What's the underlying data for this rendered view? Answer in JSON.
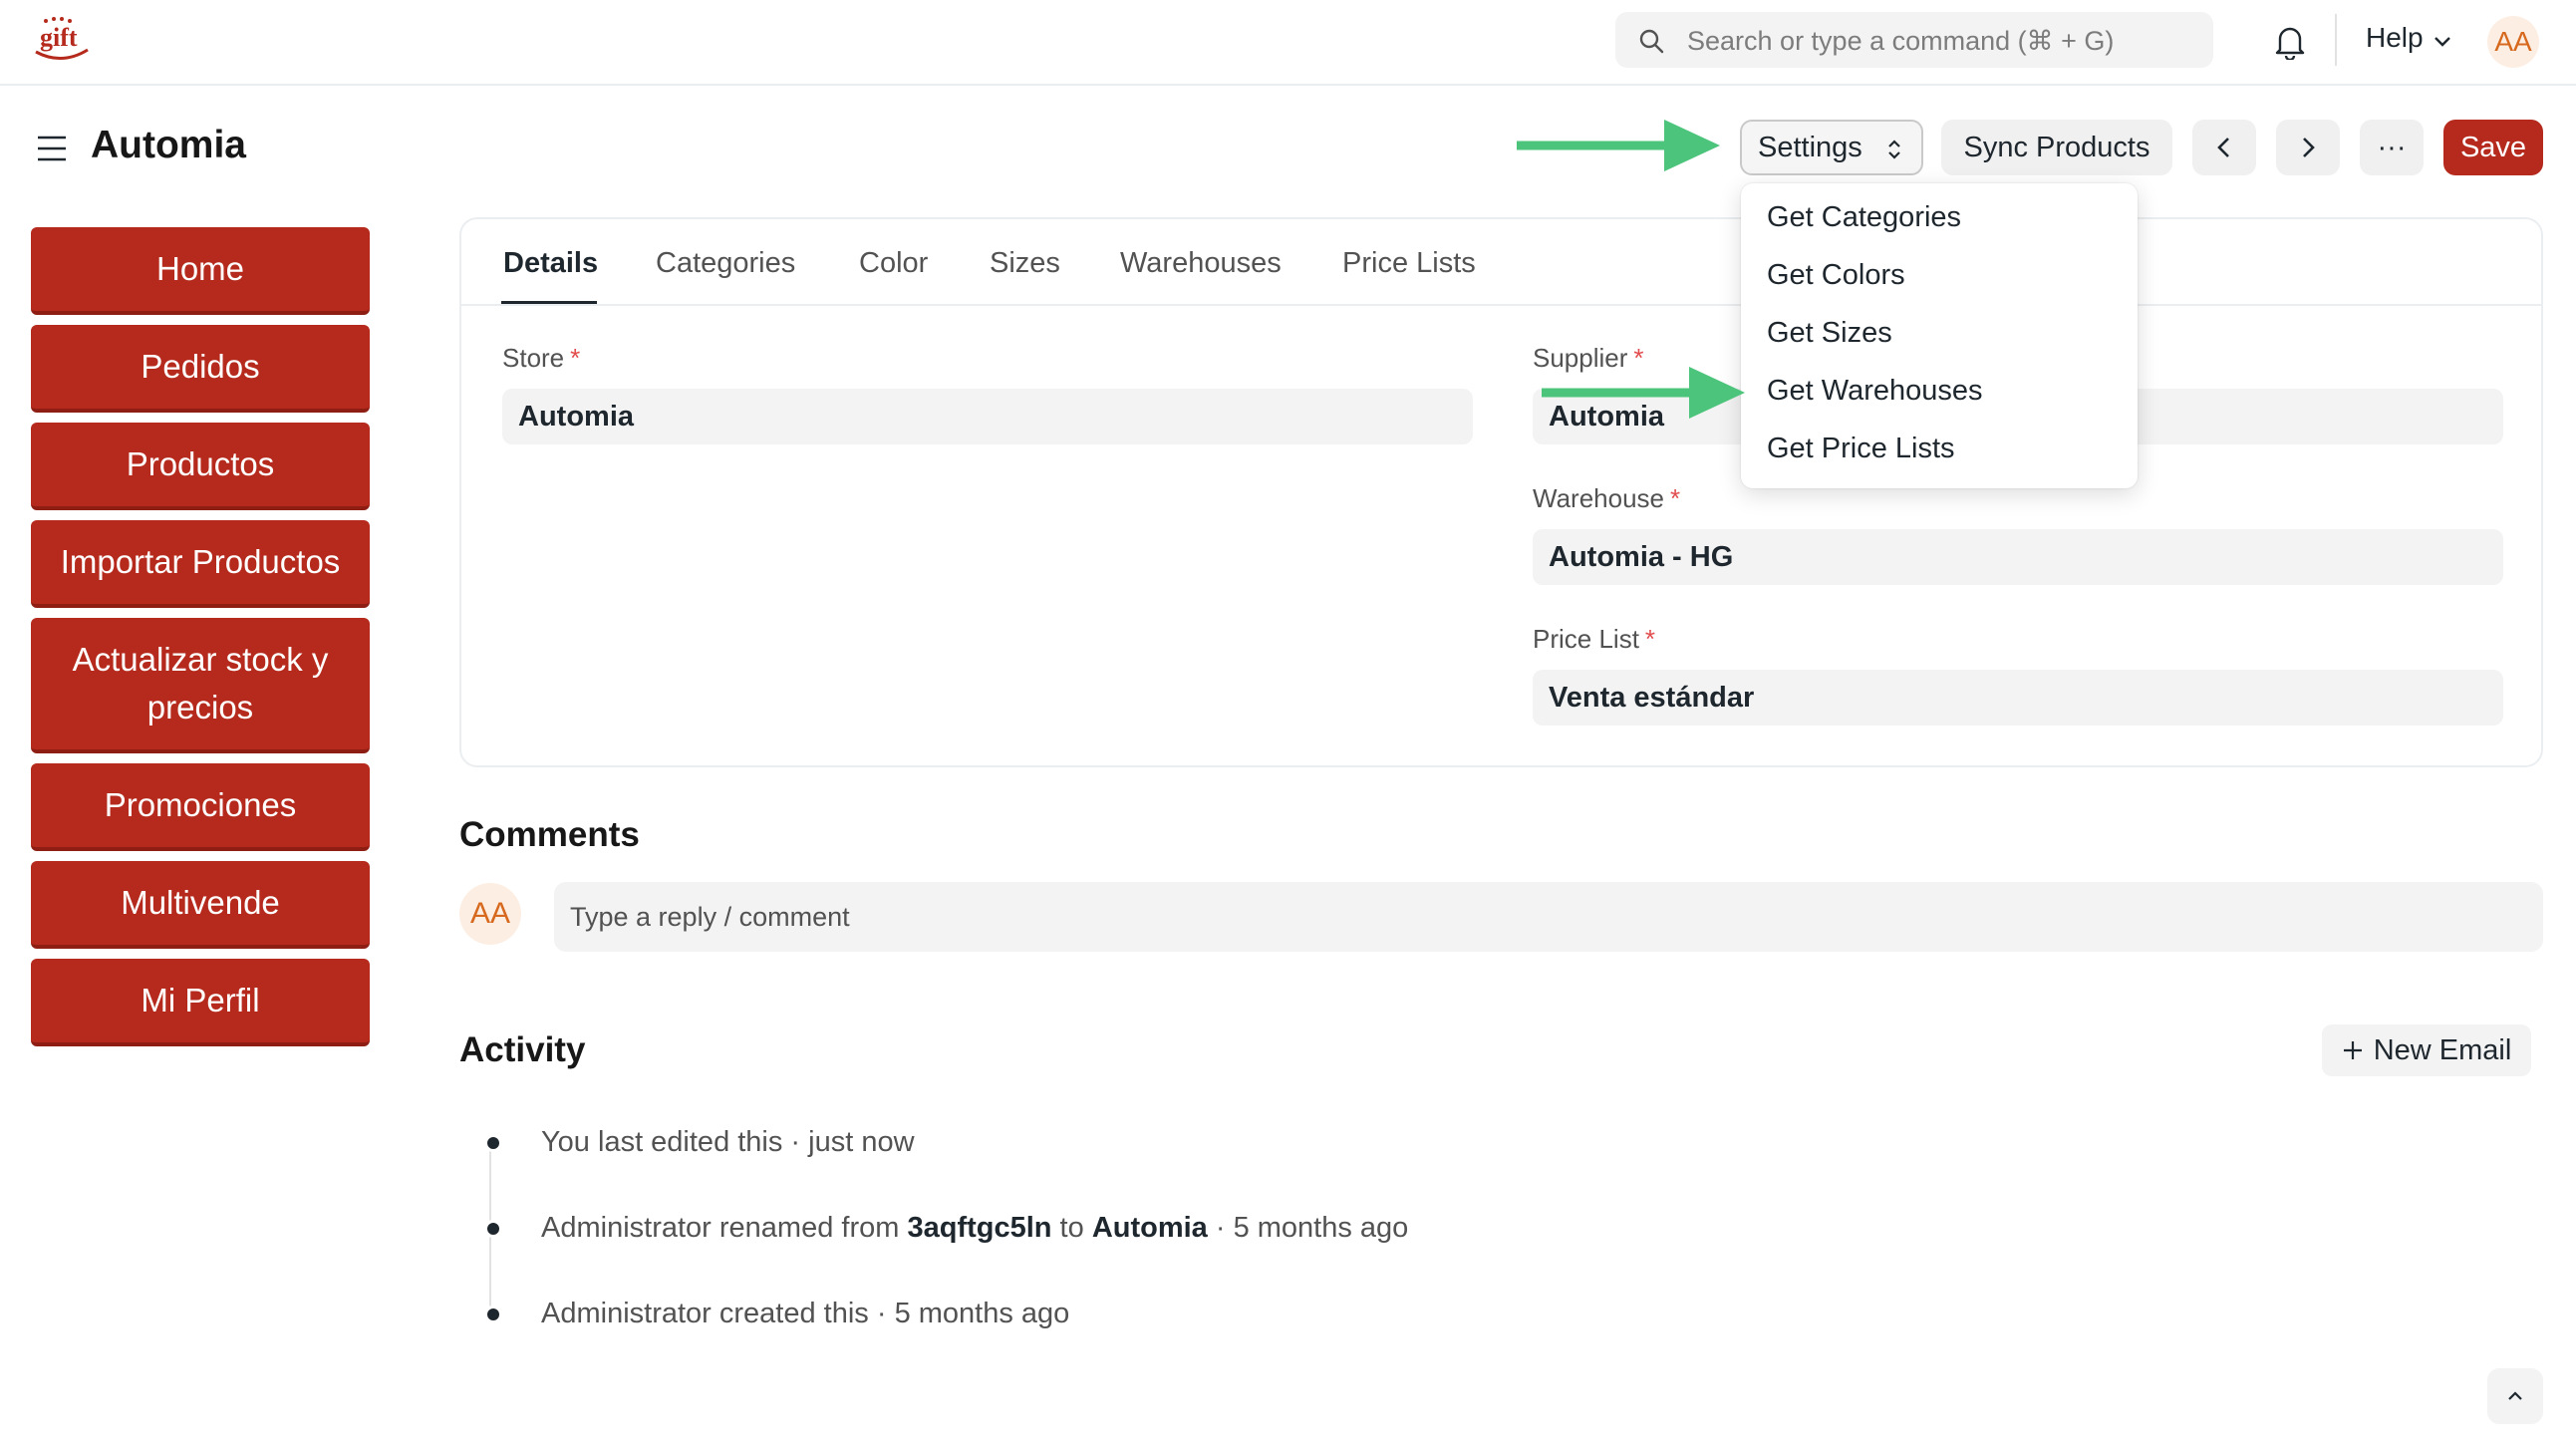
{
  "navbar": {
    "logo_text": "gift",
    "search_placeholder": "Search or type a command (⌘ + G)",
    "help_label": "Help",
    "user_initials": "AA"
  },
  "header": {
    "title": "Automia",
    "settings_label": "Settings",
    "sync_label": "Sync Products",
    "more_label": "···",
    "save_label": "Save"
  },
  "sidebar": {
    "items": [
      {
        "label": "Home"
      },
      {
        "label": "Pedidos"
      },
      {
        "label": "Productos"
      },
      {
        "label": "Importar Productos"
      },
      {
        "label": "Actualizar stock y precios"
      },
      {
        "label": "Promociones"
      },
      {
        "label": "Multivende"
      },
      {
        "label": "Mi Perfil"
      }
    ]
  },
  "tabs": [
    {
      "label": "Details",
      "active": true
    },
    {
      "label": "Categories"
    },
    {
      "label": "Color"
    },
    {
      "label": "Sizes"
    },
    {
      "label": "Warehouses"
    },
    {
      "label": "Price Lists"
    }
  ],
  "form": {
    "store": {
      "label": "Store",
      "value": "Automia",
      "required": "*"
    },
    "supplier": {
      "label": "Supplier",
      "value": "Automia",
      "required": "*"
    },
    "warehouse": {
      "label": "Warehouse",
      "value": "Automia - HG",
      "required": "*"
    },
    "price_list": {
      "label": "Price List",
      "value": "Venta estándar",
      "required": "*"
    }
  },
  "settings_menu": {
    "items": [
      {
        "label": "Get Categories"
      },
      {
        "label": "Get Colors"
      },
      {
        "label": "Get Sizes"
      },
      {
        "label": "Get Warehouses"
      },
      {
        "label": "Get Price Lists"
      }
    ]
  },
  "comments": {
    "title": "Comments",
    "user_initials": "AA",
    "placeholder": "Type a reply / comment"
  },
  "activity": {
    "title": "Activity",
    "new_email_label": "New Email",
    "items": [
      {
        "text": "You last edited this · just now"
      },
      {
        "actor": "Administrator",
        "verb": " renamed from ",
        "from": "3aqftgc5ln",
        "to_word": " to ",
        "to": "Automia",
        "time": " · 5 months ago"
      },
      {
        "actor": "Administrator",
        "verb": " created this",
        "time": " · 5 months ago"
      }
    ]
  },
  "colors": {
    "brand_red": "#b52a1d",
    "annotation_green": "#4cc47c",
    "avatar_orange": "#d6691e"
  }
}
